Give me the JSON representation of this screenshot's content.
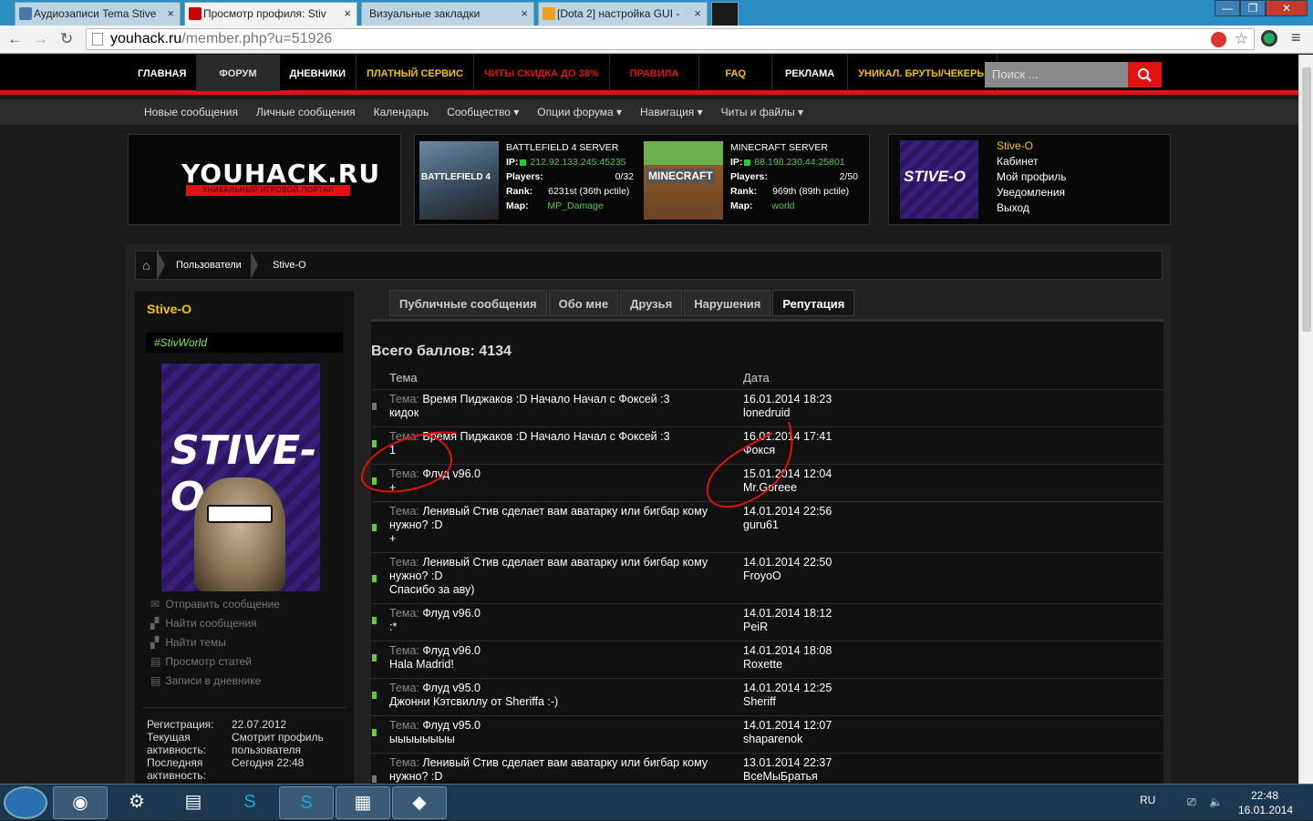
{
  "browser": {
    "tabs": [
      {
        "title": "Аудиозаписи Tema Stive",
        "active": false
      },
      {
        "title": "Просмотр профиля: Stiv",
        "active": true
      },
      {
        "title": "Визуальные закладки",
        "active": false
      },
      {
        "title": "[Dota 2] настройка GUI -",
        "active": false
      }
    ],
    "url_host": "youhack.ru",
    "url_path": "/member.php?u=51926",
    "window_buttons": [
      "—",
      "❐",
      "✕"
    ]
  },
  "topnav": {
    "items": [
      "ГЛАВНАЯ",
      "ФОРУМ",
      "ДНЕВНИКИ",
      "ПЛАТНЫЙ СЕРВИС",
      "ЧИТЫ СКИДКА ДО 38%",
      "ПРАВИЛА",
      "FAQ",
      "РЕКЛАМА",
      "УНИКАЛ. БРУТЫ/ЧЕКЕРЫ"
    ],
    "colors": [
      "#ffffff",
      "#dddddd",
      "#ffffff",
      "#f2c200",
      "#e31212",
      "#e31212",
      "#f2c200",
      "#ffffff",
      "#f2c200"
    ],
    "search_placeholder": "Поиск ..."
  },
  "subnav": [
    "Новые сообщения",
    "Личные сообщения",
    "Календарь",
    "Сообщество ▾",
    "Опции форума ▾",
    "Навигация ▾",
    "Читы и файлы ▾"
  ],
  "logo": {
    "text": "YOUHACK.RU",
    "subtitle": "УНИКАЛЬНЫЙ ИГРОВОЙ ПОРТАЛ"
  },
  "servers": [
    {
      "name": "BATTLEFIELD 4 SERVER",
      "ip": "212.92.133.245:45235",
      "players": "0/32",
      "rank": "6231st (36th pctile)",
      "map": "MP_Damage",
      "image_text": "BATTLEFIELD 4"
    },
    {
      "name": "MINECRAFT SERVER",
      "ip": "88.198.230.44:25801",
      "players": "2/50",
      "rank": "969th (89th pctile)",
      "map": "world",
      "image_text": "MINECRAFT"
    }
  ],
  "server_labels": {
    "ip": "IP:",
    "players": "Players:",
    "rank": "Rank:",
    "map": "Map:"
  },
  "usermenu": {
    "name": "Stive-O",
    "items": [
      "Кабинет",
      "Мой профиль",
      "Уведомления",
      "Выход"
    ]
  },
  "breadcrumb": {
    "users": "Пользователи",
    "current": "Stive-O"
  },
  "profile": {
    "name": "Stive-O",
    "status": "#StivWorld",
    "avatar_text": "STIVE-O",
    "links": [
      "Отправить сообщение",
      "Найти сообщения",
      "Найти темы",
      "Просмотр статей",
      "Записи в дневнике"
    ],
    "details": [
      {
        "key": "Регистрация:",
        "value": "22.07.2012"
      },
      {
        "key": "Текущая активность:",
        "value": "Смотрит профиль пользователя"
      },
      {
        "key": "Последняя активность:",
        "value": "Сегодня 22:48"
      }
    ]
  },
  "profile_tabs": [
    "Публичные сообщения",
    "Обо мне",
    "Друзья",
    "Нарушения",
    "Репутация"
  ],
  "reputation": {
    "total": "Всего баллов: 4134",
    "col_topic": "Тема",
    "col_date": "Дата",
    "topic_label": "Тема:",
    "rows": [
      {
        "topic": "Время Пиджаков :D Начало Начал с Фоксей :3",
        "comment": "кидок",
        "date": "16.01.2014 18:23",
        "user": "lonedruid",
        "positive": false
      },
      {
        "topic": "Время Пиджаков :D Начало Начал с Фоксей :3",
        "comment": "1",
        "date": "16.01.2014 17:41",
        "user": "Фокся",
        "positive": true
      },
      {
        "topic": "Флуд v96.0",
        "comment": "+",
        "date": "15.01.2014 12:04",
        "user": "Mr.Goreee",
        "positive": true
      },
      {
        "topic": "Ленивый Стив сделает вам аватарку или бигбар кому нужно? :D",
        "comment": "+",
        "date": "14.01.2014 22:56",
        "user": "guru61",
        "positive": true
      },
      {
        "topic": "Ленивый Стив сделает вам аватарку или бигбар кому нужно? :D",
        "comment": "Спасибо за аву)",
        "date": "14.01.2014 22:50",
        "user": "FroyoO",
        "positive": true
      },
      {
        "topic": "Флуд v96.0",
        "comment": ":*",
        "date": "14.01.2014 18:12",
        "user": "PeiR",
        "positive": true
      },
      {
        "topic": "Флуд v96.0",
        "comment": "Hala Madrid!",
        "date": "14.01.2014 18:08",
        "user": "Roxette",
        "positive": true
      },
      {
        "topic": "Флуд v95.0",
        "comment": "Джонни Кэтсвиллу от Sheriffa :-)",
        "date": "14.01.2014 12:25",
        "user": "Sheriff",
        "positive": true
      },
      {
        "topic": "Флуд v95.0",
        "comment": "ыыыыыыыы",
        "date": "14.01.2014 12:07",
        "user": "shaparenok",
        "positive": true
      },
      {
        "topic": "Ленивый Стив сделает вам аватарку или бигбар кому нужно? :D",
        "comment": "",
        "date": "13.01.2014 22:37",
        "user": "ВсеМыБратья",
        "positive": false
      }
    ]
  },
  "taskbar": {
    "lang": "RU",
    "time": "22:48",
    "date": "16.01.2014"
  }
}
